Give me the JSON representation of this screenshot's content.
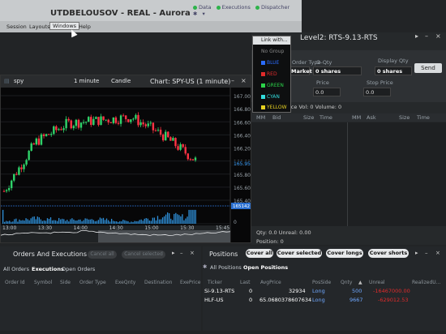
{
  "app": {
    "title": "UTDBELOUSOV - REAL - Aurora",
    "status": [
      "Data",
      "Executions",
      "Dispatcher"
    ],
    "status_colors": [
      "#2db34a",
      "#2db34a",
      "#2db34a"
    ],
    "menu": [
      "Session",
      "Layouts",
      "Windows",
      "Help"
    ]
  },
  "chart": {
    "symbol": "spy",
    "interval": "1 minute",
    "style": "Candle",
    "title": "Chart: SPY-US (1 minute)",
    "price_ticks": [
      "167.00",
      "166.80",
      "166.60",
      "166.40",
      "166.20",
      "166.00",
      "165.80",
      "165.60",
      "165.40"
    ],
    "last_price_tag": "165.95",
    "cursor_price_tag": "165142",
    "volume_tick": "0",
    "time_ticks": [
      "13:00",
      "13:30",
      "14:00",
      "14:30",
      "15:00",
      "15:30",
      "15:45"
    ],
    "candle_color_up": "#2fd36a",
    "candle_color_down": "#ff3344"
  },
  "chart_data": {
    "type": "line",
    "title": "Chart: SPY-US (1 minute)",
    "xlabel": "",
    "ylabel": "",
    "x": [
      "13:00",
      "13:30",
      "14:00",
      "14:30",
      "15:00",
      "15:30",
      "15:45"
    ],
    "ylim": [
      165.3,
      167.1
    ],
    "series": [
      {
        "name": "",
        "values": [
          165.5,
          166.3,
          166.6,
          166.65,
          166.7,
          166.4,
          166.0
        ]
      }
    ],
    "volume": [
      0.2,
      0.35,
      0.25,
      0.3,
      0.15,
      0.55,
      0.4
    ],
    "grid": true
  },
  "linkwith": {
    "header": "Link with...",
    "items": [
      "No Group",
      "BLUE",
      "RED",
      "GREEN",
      "CYAN",
      "YELLOW"
    ],
    "colors": [
      "#777777",
      "#2b6cff",
      "#e02b2b",
      "#2bd44a",
      "#33dddd",
      "#e6d020"
    ]
  },
  "level2": {
    "title": "Level2: RTS-9.13-RTS",
    "order_type_label": "Order Type",
    "order_type_value": "Market",
    "order_qty_label": "O-Qty",
    "order_qty_value": "0 shares",
    "display_qty_label": "Display Qty",
    "display_qty_value": "0 shares",
    "send_label": "Send",
    "price_label": "Price",
    "price_value": "0.0",
    "stop_price_label": "Stop Price",
    "stop_price_value": "0.0",
    "stats": "0.00  Imbalance Vol: 0  Volume: 0",
    "columns_left": [
      "MM",
      "Bid",
      "Size",
      "Time"
    ],
    "columns_right": [
      "MM",
      "Ask",
      "Size",
      "Time"
    ],
    "qty_line": "Qty: 0.0   Unreal: 0.00",
    "position_line": "Position: 0"
  },
  "orders": {
    "title": "Orders And Executions",
    "cancel_all": "Cancel all",
    "cancel_selected": "Cancel selected",
    "tabs": [
      "All Orders",
      "Executions",
      "Open Orders"
    ],
    "columns": [
      "Order Id",
      "Symbol",
      "Side",
      "Order Type",
      "ExeQnty",
      "Destination",
      "ExePrice"
    ]
  },
  "positions": {
    "title": "Positions",
    "buttons": [
      "Cover all",
      "Cover selected",
      "Cover longs",
      "Cover shorts"
    ],
    "tabs": [
      "All Positions",
      "Open Positions"
    ],
    "columns": [
      "Ticker",
      "Last",
      "AvgPrice",
      "PosSide",
      "Qnty",
      "Unreal",
      "RealizedU..."
    ],
    "rows": [
      {
        "ticker": "Si-9.13-RTS",
        "last": "0",
        "avg": "32934",
        "side": "Long",
        "qty": "500",
        "unreal": "-16467000.00",
        "realized": ""
      },
      {
        "ticker": "HLF-US",
        "last": "0",
        "avg": "65.0680378607634",
        "side": "Long",
        "qty": "9667",
        "unreal": "-629012.53",
        "realized": ""
      }
    ]
  }
}
